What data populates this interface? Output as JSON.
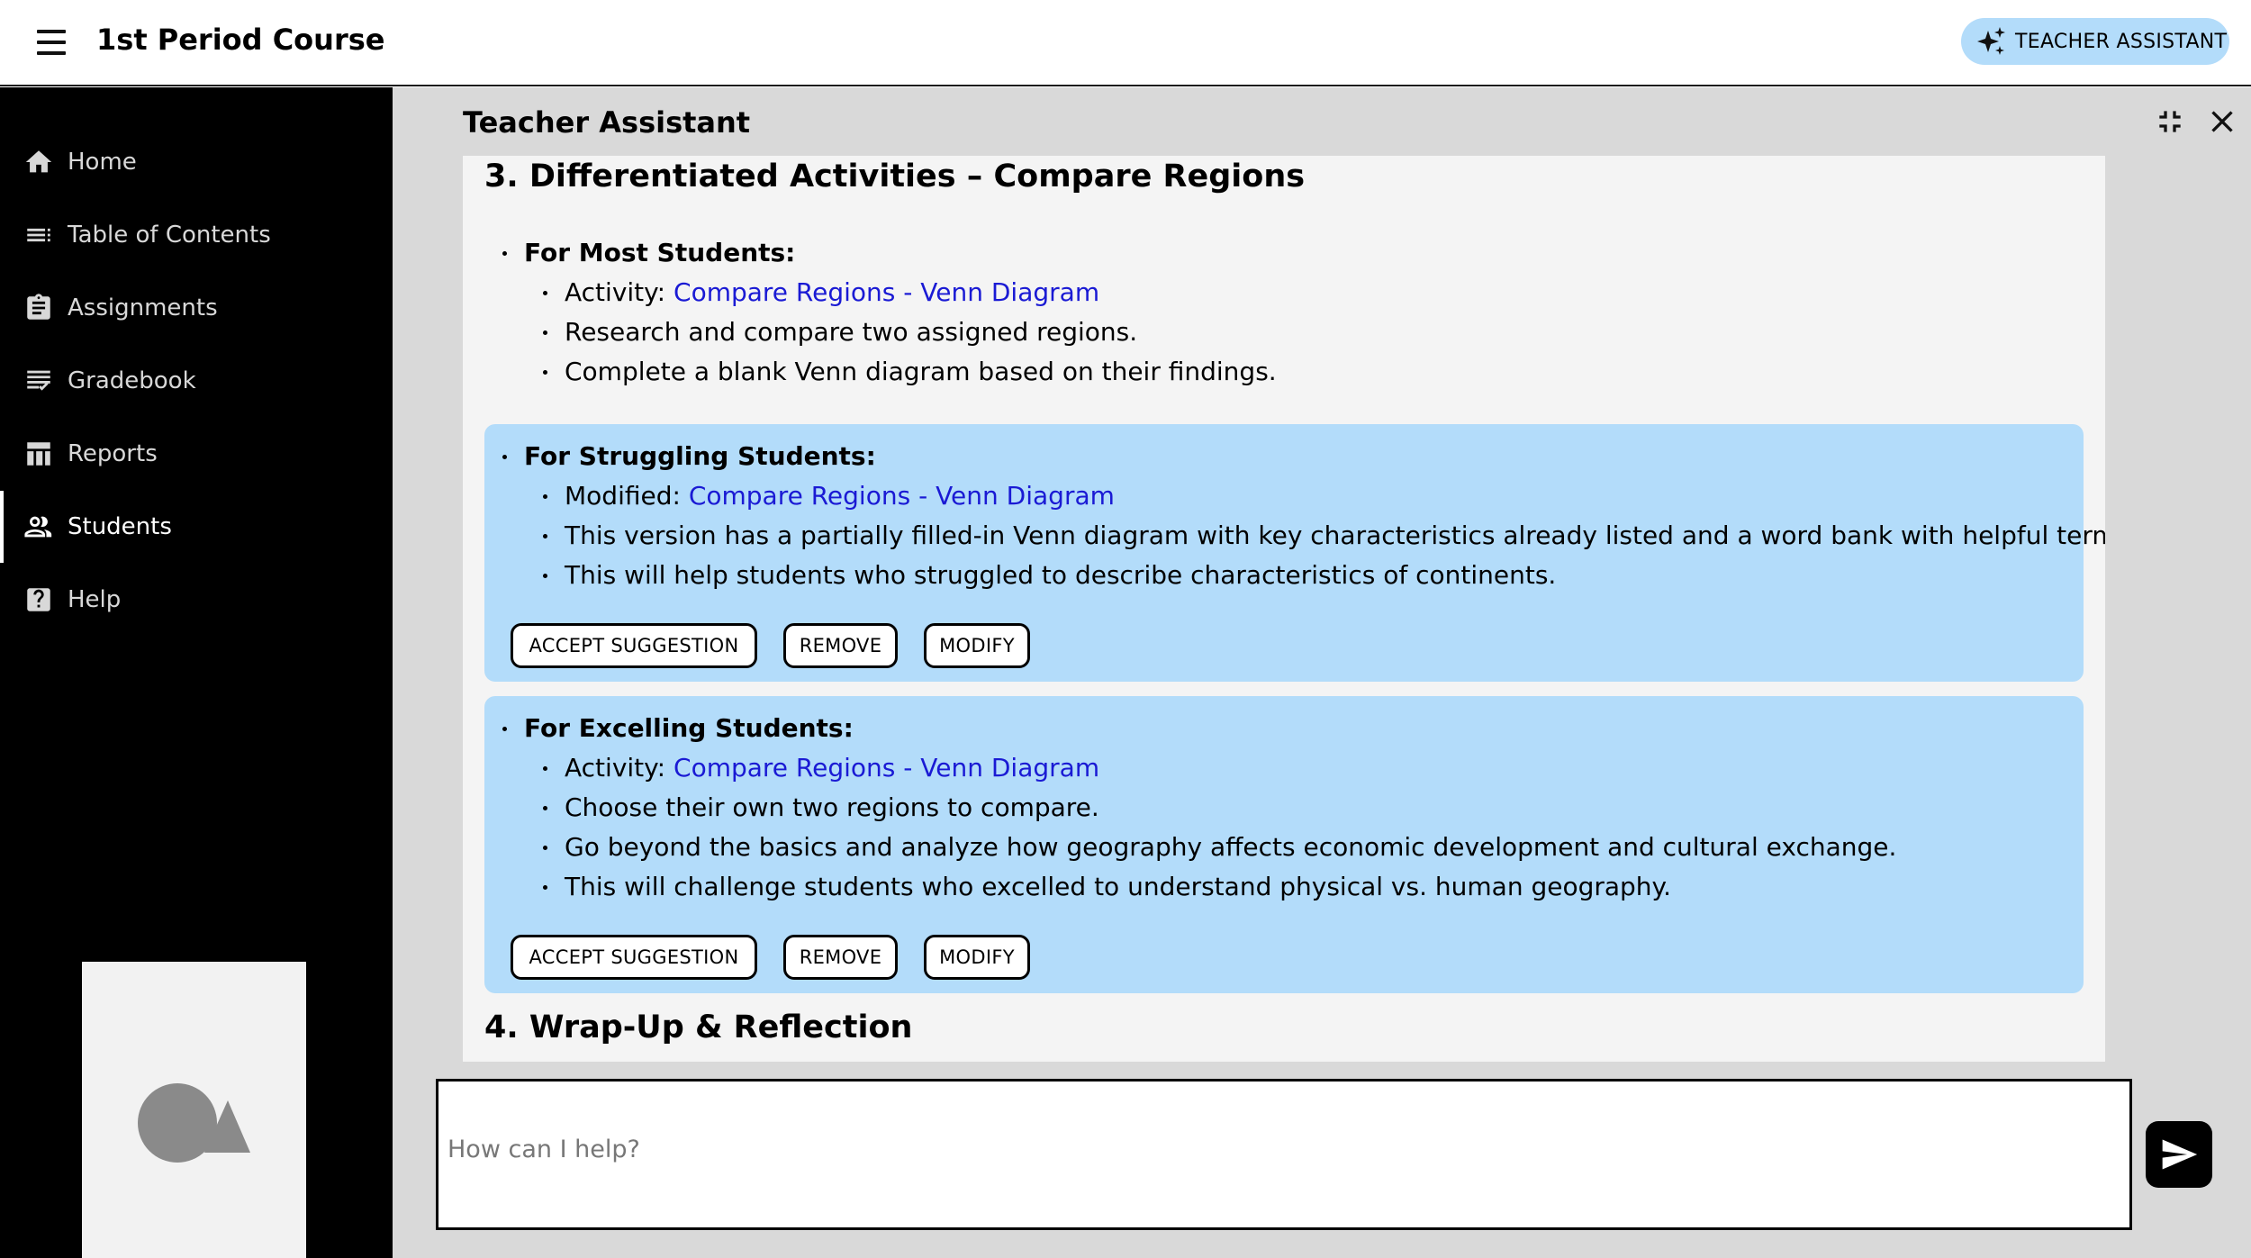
{
  "header": {
    "menu_icon": "hamburger-menu-icon",
    "course_title": "1st Period Course",
    "assistant_button": {
      "label": "TEACHER ASSISTANT",
      "icon": "sparkle-icon",
      "color": "#b3dcfa"
    }
  },
  "sidebar": {
    "background": "#000000",
    "items": [
      {
        "label": "Home",
        "icon": "home-icon"
      },
      {
        "label": "Table of Contents",
        "icon": "list-icon"
      },
      {
        "label": "Assignments",
        "icon": "clipboard-icon"
      },
      {
        "label": "Gradebook",
        "icon": "gradebook-icon"
      },
      {
        "label": "Reports",
        "icon": "table-icon"
      },
      {
        "label": "Students",
        "icon": "people-icon",
        "active": true
      },
      {
        "label": "Help",
        "icon": "help-icon"
      }
    ],
    "logo_icon": "shapes-logo-icon"
  },
  "assistant": {
    "title": "Teacher Assistant",
    "collapse_icon": "collapse-icon",
    "close_icon": "close-icon",
    "sections": [
      {
        "heading": "3. Differentiated Activities – Compare Regions"
      },
      {
        "heading": "4. Wrap-Up & Reflection"
      }
    ],
    "groups": [
      {
        "title": "For Most Students:",
        "highlighted": false,
        "items": [
          {
            "prefix": "Activity: ",
            "link": "Compare Regions - Venn Diagram"
          },
          {
            "text": "Research and compare two assigned regions."
          },
          {
            "text": "Complete a blank Venn diagram based on their findings."
          }
        ]
      },
      {
        "title": "For Struggling Students:",
        "highlighted": true,
        "items": [
          {
            "prefix": "Modified: ",
            "link": "Compare Regions - Venn Diagram"
          },
          {
            "text": "This version has a partially filled-in Venn diagram with key characteristics already listed and a word bank with helpful terms."
          },
          {
            "text": "This will help students who struggled to describe characteristics of continents."
          }
        ],
        "actions": [
          "ACCEPT SUGGESTION",
          "REMOVE",
          "MODIFY"
        ]
      },
      {
        "title": "For Excelling Students:",
        "highlighted": true,
        "items": [
          {
            "prefix": "Activity: ",
            "link": "Compare Regions - Venn Diagram"
          },
          {
            "text": "Choose their own two regions to compare."
          },
          {
            "text": "Go beyond the basics and analyze how geography affects economic development and cultural exchange."
          },
          {
            "text": "This will challenge students who excelled to understand physical vs. human geography."
          }
        ],
        "actions": [
          "ACCEPT SUGGESTION",
          "REMOVE",
          "MODIFY"
        ]
      }
    ],
    "highlight_color": "#b3dcfa",
    "link_color": "#1a1ad4",
    "input": {
      "placeholder": "How can I help?",
      "value": ""
    },
    "send_icon": "send-icon"
  }
}
